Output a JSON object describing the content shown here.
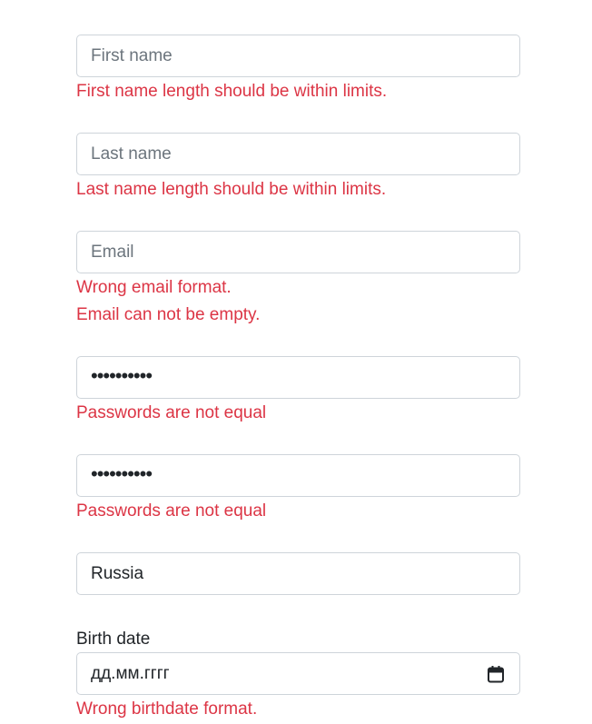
{
  "form": {
    "first_name": {
      "placeholder": "First name",
      "value": "",
      "errors": [
        "First name length should be within limits."
      ]
    },
    "last_name": {
      "placeholder": "Last name",
      "value": "",
      "errors": [
        "Last name length should be within limits."
      ]
    },
    "email": {
      "placeholder": "Email",
      "value": "",
      "errors": [
        "Wrong email format.",
        "Email can not be empty."
      ]
    },
    "password": {
      "masked_value": "••••••••••",
      "errors": [
        "Passwords are not equal"
      ]
    },
    "confirm_password": {
      "masked_value": "••••••••••",
      "errors": [
        "Passwords are not equal"
      ]
    },
    "country": {
      "value": "Russia"
    },
    "birth_date": {
      "label": "Birth date",
      "placeholder": "дд.мм.гггг",
      "icon": "calendar-icon",
      "errors": [
        "Wrong birthdate format."
      ]
    }
  },
  "colors": {
    "error": "#dc3545",
    "border": "#ced4da",
    "placeholder": "#6c757d",
    "text": "#212529"
  }
}
